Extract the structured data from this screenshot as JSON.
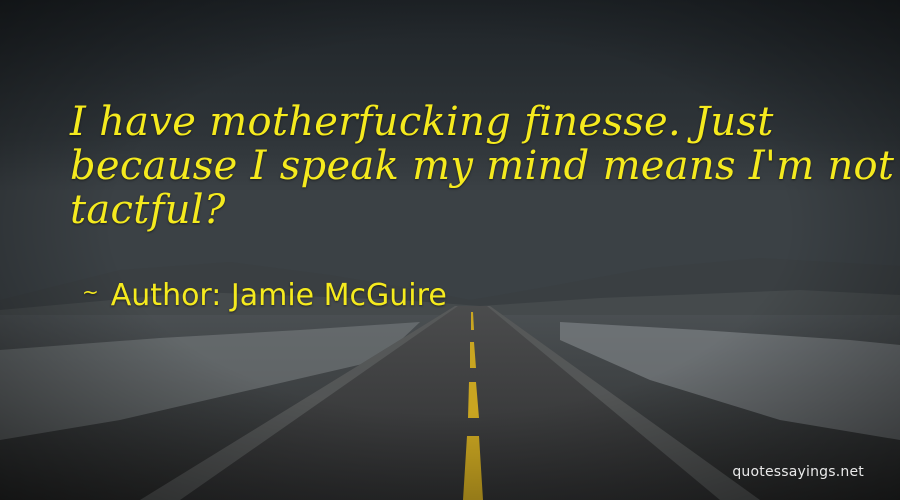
{
  "quote": {
    "lines": [
      "I have motherfucking finesse. Just",
      "because I speak my mind means I'm not",
      "tactful?"
    ]
  },
  "author": {
    "tilde": "~",
    "text": "Author: Jamie McGuire"
  },
  "watermark": "quotessayings.net",
  "colors": {
    "quote_text": "#f5ea1e",
    "watermark": "#ffffff",
    "sky": "#2a2f33",
    "road": "#3b3d3e",
    "center_line": "#c9a521"
  }
}
